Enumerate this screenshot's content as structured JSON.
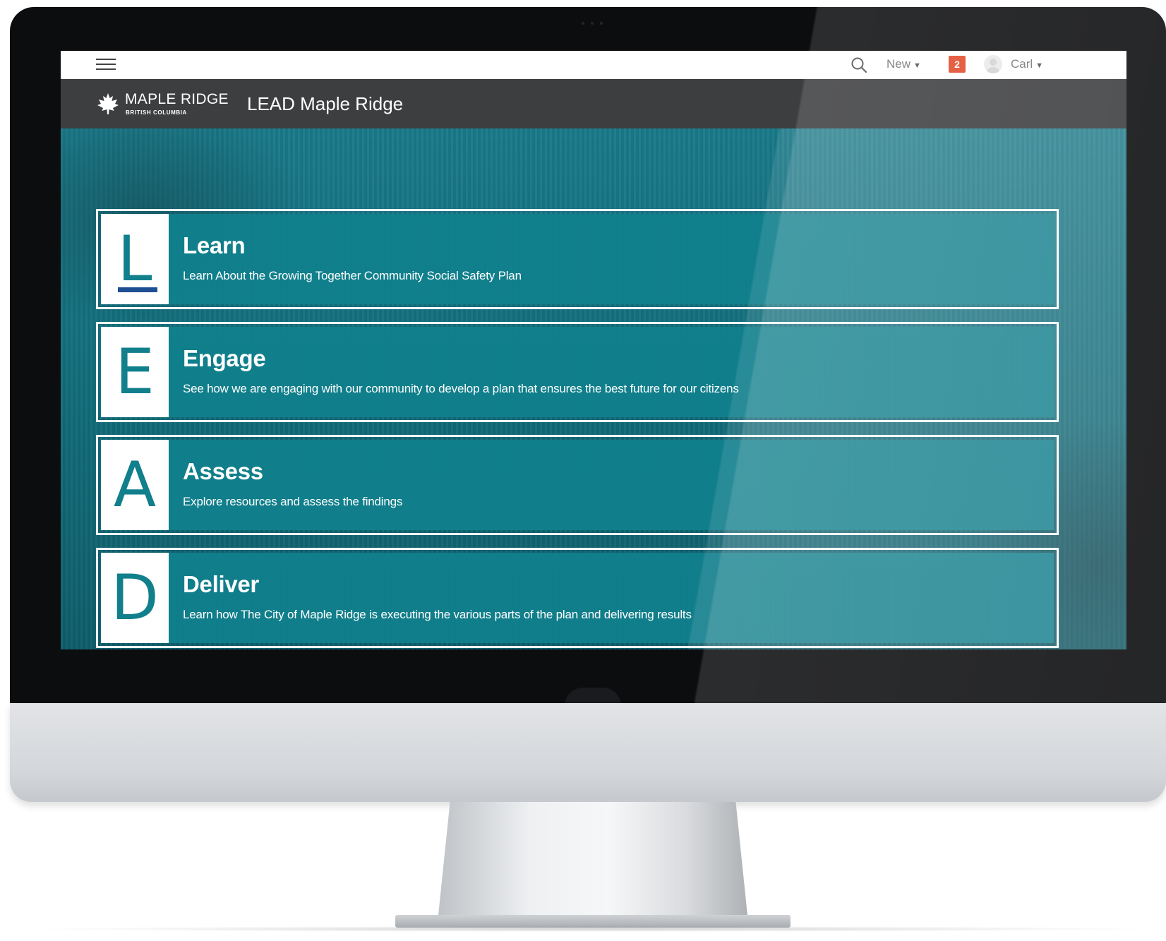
{
  "topbar": {
    "menu_icon": "hamburger-menu-icon",
    "search_icon": "search-icon",
    "new_label": "New",
    "notification_count": "2",
    "user_name": "Carl"
  },
  "brand": {
    "name": "MAPLE RIDGE",
    "subtitle": "BRITISH COLUMBIA",
    "site_title": "LEAD Maple Ridge",
    "logo_icon": "maple-leaf-icon"
  },
  "cards": [
    {
      "letter": "L",
      "title": "Learn",
      "description": "Learn About the Growing Together Community Social Safety Plan"
    },
    {
      "letter": "E",
      "title": "Engage",
      "description": "See how we are engaging with our community to develop a plan that ensures the best future for our citizens"
    },
    {
      "letter": "A",
      "title": "Assess",
      "description": "Explore resources and assess the findings"
    },
    {
      "letter": "D",
      "title": "Deliver",
      "description": "Learn how The City of Maple Ridge is executing the various parts of the plan and delivering results"
    }
  ],
  "colors": {
    "teal": "#117f8c",
    "brand_bar": "#3d3e40",
    "badge": "#e24a2b",
    "underline_blue": "#1f4f93"
  }
}
